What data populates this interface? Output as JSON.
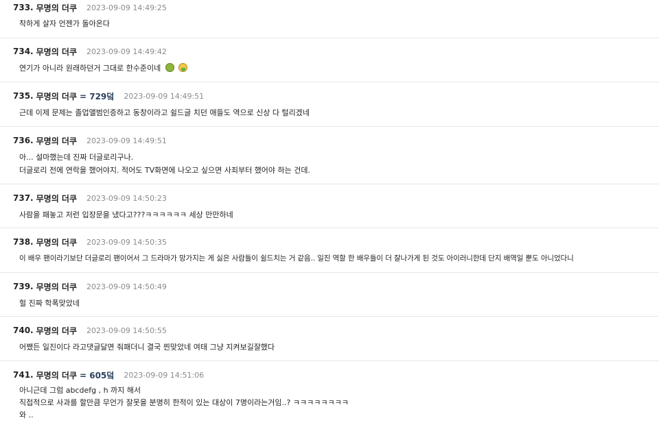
{
  "comments": [
    {
      "num": "733.",
      "author": "무명의 더쿠",
      "ref": "",
      "time": "2023-09-09 14:49:25",
      "lines": [
        "착하게 살자 언젠가 돌아온다"
      ]
    },
    {
      "num": "734.",
      "author": "무명의 더쿠",
      "ref": "",
      "time": "2023-09-09 14:49:42",
      "lines": [
        "연기가 아니라 원래하던거 그대로 한수준이네"
      ],
      "emojis": [
        "nauseated-face-icon",
        "face-vomiting-icon"
      ]
    },
    {
      "num": "735.",
      "author": "무명의 더쿠",
      "ref": "= 729덬",
      "time": "2023-09-09 14:49:51",
      "lines": [
        "근데 이제 문제는 졸업앨범인증하고 동창이라고 쉴드글 치던 애들도 역으로 신상 다 털리겠네"
      ]
    },
    {
      "num": "736.",
      "author": "무명의 더쿠",
      "ref": "",
      "time": "2023-09-09 14:49:51",
      "lines": [
        "아... 설마했는데 진짜 더글로리구나.",
        "더글로리 전에 연락을 했어야지. 적어도 TV화면에 나오고 싶으면 사죄부터 했어야 하는 건데."
      ]
    },
    {
      "num": "737.",
      "author": "무명의 더쿠",
      "ref": "",
      "time": "2023-09-09 14:50:23",
      "lines": [
        "사람을 패놓고 저런 입장문을 냈다고???ㅋㅋㅋㅋㅋㅋ 세상 만만하네"
      ]
    },
    {
      "num": "738.",
      "author": "무명의 더쿠",
      "ref": "",
      "time": "2023-09-09 14:50:35",
      "lines": [
        "이 배우 팬이라기보단 더글로리 팬이어서 그 드라마가 망가지는 게 싫은 사람들이 쉴드치는 거 같음.. 일진 역할 한 배우들이 더 잘나가게 된 것도 아이러니한데 단지 배역일 뿐도 아니었다니"
      ]
    },
    {
      "num": "739.",
      "author": "무명의 더쿠",
      "ref": "",
      "time": "2023-09-09 14:50:49",
      "lines": [
        "헐 진짜 학폭맞았네"
      ]
    },
    {
      "num": "740.",
      "author": "무명의 더쿠",
      "ref": "",
      "time": "2023-09-09 14:50:55",
      "lines": [
        "어쨌든 일진이다 라고댓글달면 줘패더니 결국 찐맞았네 여태 그냥 지켜보길잘했다"
      ]
    },
    {
      "num": "741.",
      "author": "무명의 더쿠",
      "ref": "= 605덬",
      "time": "2023-09-09 14:51:06",
      "lines": [
        "아니근데 그럼 abcdefg , h 까지 해서",
        "직접적으로 사과를 할만큼 무언가 잘못을 분명히 한적이 있는 대상이 7명이라는거임..? ㅋㅋㅋㅋㅋㅋㅋㅋ",
        "와 .."
      ]
    }
  ]
}
